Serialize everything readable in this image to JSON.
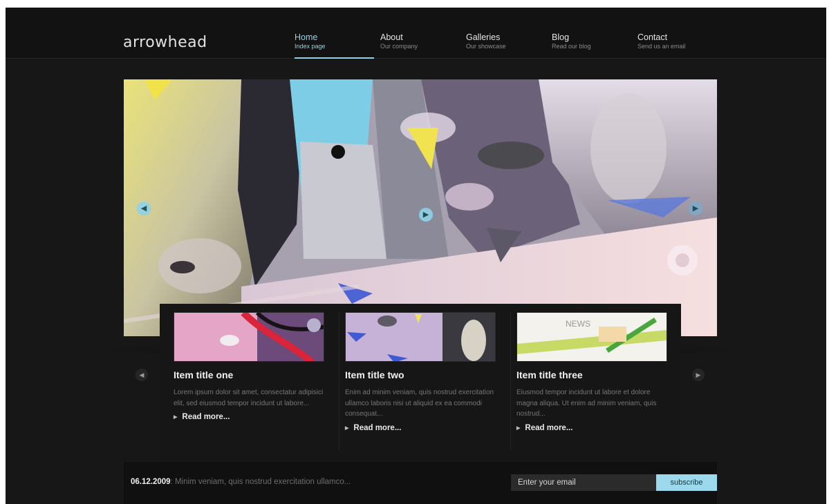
{
  "header": {
    "logo": "arrowhead",
    "nav": [
      {
        "title": "Home",
        "subtitle": "Index page",
        "active": true
      },
      {
        "title": "About",
        "subtitle": "Our company"
      },
      {
        "title": "Galleries",
        "subtitle": "Our showcase"
      },
      {
        "title": "Blog",
        "subtitle": "Read our blog"
      },
      {
        "title": "Contact",
        "subtitle": "Send us an email"
      }
    ]
  },
  "hero": {
    "prev_icon": "arrow-left",
    "play_icon": "play",
    "next_icon": "arrow-right"
  },
  "featured": {
    "items": [
      {
        "title": "Item title one",
        "text": "Lorem ipsum dolor sit amet, consectatur adipisici elit, sed eiusmod tempor incidunt ut labore...",
        "link": "Read more..."
      },
      {
        "title": "Item title two",
        "text": "Enim ad minim veniam, quis nostrud exercitation ullamco laboris nisi ut aliquid ex ea commodi consequat...",
        "link": "Read more..."
      },
      {
        "title": "Item title three",
        "text": "Eiusmod tempor incidunt ut labore et dolore magna aliqua. Ut enim ad minim veniam, quis nostrud...",
        "link": "Read more..."
      }
    ],
    "thumb3_label": "NEWS"
  },
  "footer": {
    "date": "06.12.2009",
    "news_text": ": Minim veniam, quis nostrud exercitation ullamco...",
    "email_placeholder": "Enter your email",
    "subscribe_label": "subscribe"
  },
  "colors": {
    "accent": "#8fd3ea",
    "background": "#171717",
    "header": "#121212"
  }
}
